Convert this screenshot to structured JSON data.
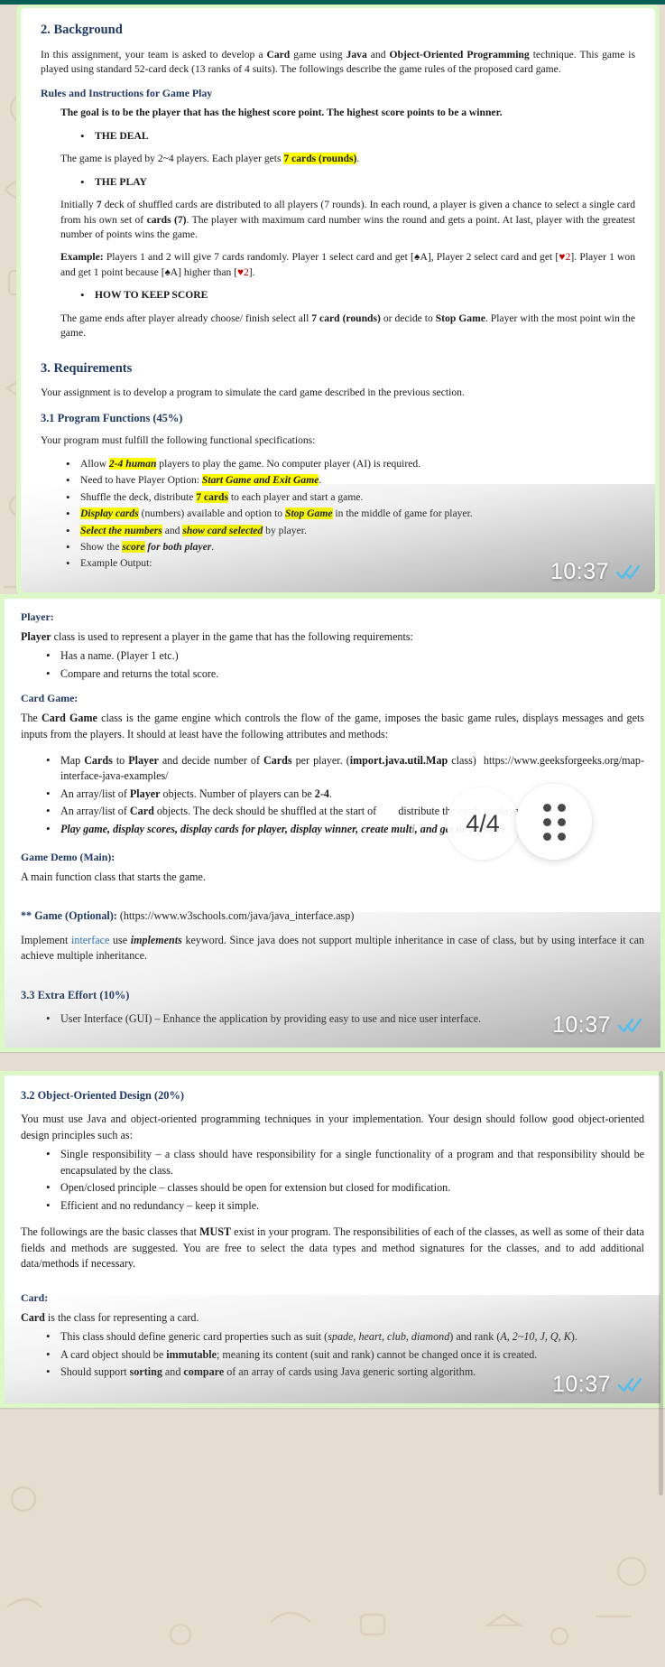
{
  "app": {
    "accent": "#075e54",
    "bubble_color": "#dcf8c6",
    "wallpaper_color": "#e6ddd1",
    "tick_color": "#53bdeb"
  },
  "overlays": {
    "page_indicator": "4/4",
    "apps_fab_icon": "apps-grid-icon"
  },
  "messages": [
    {
      "time": "10:37",
      "status": "read",
      "doc": {
        "h_background": "2. Background",
        "p_background": "In this assignment, your team is asked to develop a Card game using Java and Object-Oriented Programming technique. This game is played using standard 52-card deck (13 ranks of 4 suits). The followings describe the game rules of the proposed card game.",
        "h_rules": "Rules and Instructions for Game Play",
        "p_goal": "The goal is to be the player that has the highest score point. The highest score points to be a winner.",
        "b_deal": "THE DEAL",
        "p_deal": "The game is played by 2~4 players. Each player gets 7 cards (rounds).",
        "b_play": "THE PLAY",
        "p_play": "Initially 7 deck of shuffled cards are distributed to all players (7 rounds). In each round, a player is given a chance to select a single card from his own set of cards (7). The player with maximum card number wins the round and gets a point. At last, player with the greatest number of points wins the game.",
        "p_example": "Example: Players 1 and 2 will give 7 cards randomly. Player 1 select card and get [♠A], Player 2 select card and get [♥2]. Player 1 won and get 1 point because [♠A] higher than [♥2].",
        "b_score": "HOW TO KEEP SCORE",
        "p_score": "The game ends after player already choose/ finish select all 7 card (rounds) or decide to Stop Game. Player with the most point win the game.",
        "h_requirements": "3. Requirements",
        "p_requirements": "Your assignment is to develop a program to simulate the card game described in the previous section.",
        "h_program_functions": "3.1 Program Functions (45%)",
        "p_program_functions": "Your program must fulfill the following functional specifications:",
        "bullets": [
          "Allow 2-4 human players to play the game. No computer player (AI) is required.",
          "Need to have Player Option: Start Game and Exit Game.",
          "Shuffle the deck, distribute 7 cards to each player and start a game.",
          "Display cards (numbers) available and option to Stop Game in the middle of game for player.",
          "Select the numbers and show card selected by player.",
          "Show the score for both player.",
          "Example Output:"
        ]
      }
    },
    {
      "time": "10:37",
      "status": "read",
      "doc": {
        "h_player": "Player:",
        "p_player": "Player class is used to represent a player in the game that has the following requirements:",
        "player_bullets": [
          "Has a name. (Player 1 etc.)",
          "Compare and returns the total score."
        ],
        "h_cardgame": "Card Game:",
        "p_cardgame": "The Card Game class is the game engine which controls the flow of the game, imposes the basic game rules, displays messages and gets inputs from the players. It should at least have the following attributes and methods:",
        "cardgame_bullets": [
          "Map Cards to Player and decide number of Cards per player. (import.java.util.Map class) https://www.geeksforgeeks.org/map-interface-java-examples/",
          "An array/list of Player objects. Number of players can be 2-4.",
          "An array/list of Card objects. The deck should be shuffled at the start of distribute the cards to player.",
          "Play game, display scores, display cards for player, display winner, create muh. and get next player"
        ],
        "h_gamedemo": "Game Demo (Main):",
        "p_gamedemo": "A main function class that starts the game.",
        "h_optional": "** Game (Optional): (https://www.w3schools.com/java/java_interface.asp)",
        "p_optional": "Implement interface use implements keyword. Since java does not support multiple inheritance in case of class, but by using interface it can achieve multiple inheritance.",
        "h_extra": "3.3 Extra Effort (10%)",
        "extra_bullets": [
          "User Interface (GUI) – Enhance the application by providing easy to use and nice user interface."
        ]
      }
    },
    {
      "time": "10:37",
      "status": "read",
      "doc": {
        "h_ood": "3.2 Object-Oriented Design (20%)",
        "p_ood": "You must use Java and object-oriented programming techniques in your implementation. Your design should follow good object-oriented design principles such as:",
        "ood_bullets": [
          "Single responsibility – a class should have responsibility for a single functionality of a program and that responsibility should be encapsulated by the class.",
          "Open/closed principle – classes should be open for extension but closed for modification.",
          "Efficient and no redundancy – keep it simple."
        ],
        "p_followings": "The followings are the basic classes that MUST exist in your program. The responsibilities of each of the classes, as well as some of their data fields and methods are suggested. You are free to select the data types and method signatures for the classes, and to add additional data/methods if necessary.",
        "h_card": "Card:",
        "p_card": "Card is the class for representing a card.",
        "card_bullets": [
          "This class should define generic card properties such as suit (spade, heart, club, diamond) and rank (A, 2~10, J, Q, K).",
          "A card object should be immutable; meaning its content (suit and rank) cannot be changed once it is created.",
          "Should support sorting and compare of an array of cards using Java generic sorting algorithm."
        ]
      }
    }
  ]
}
